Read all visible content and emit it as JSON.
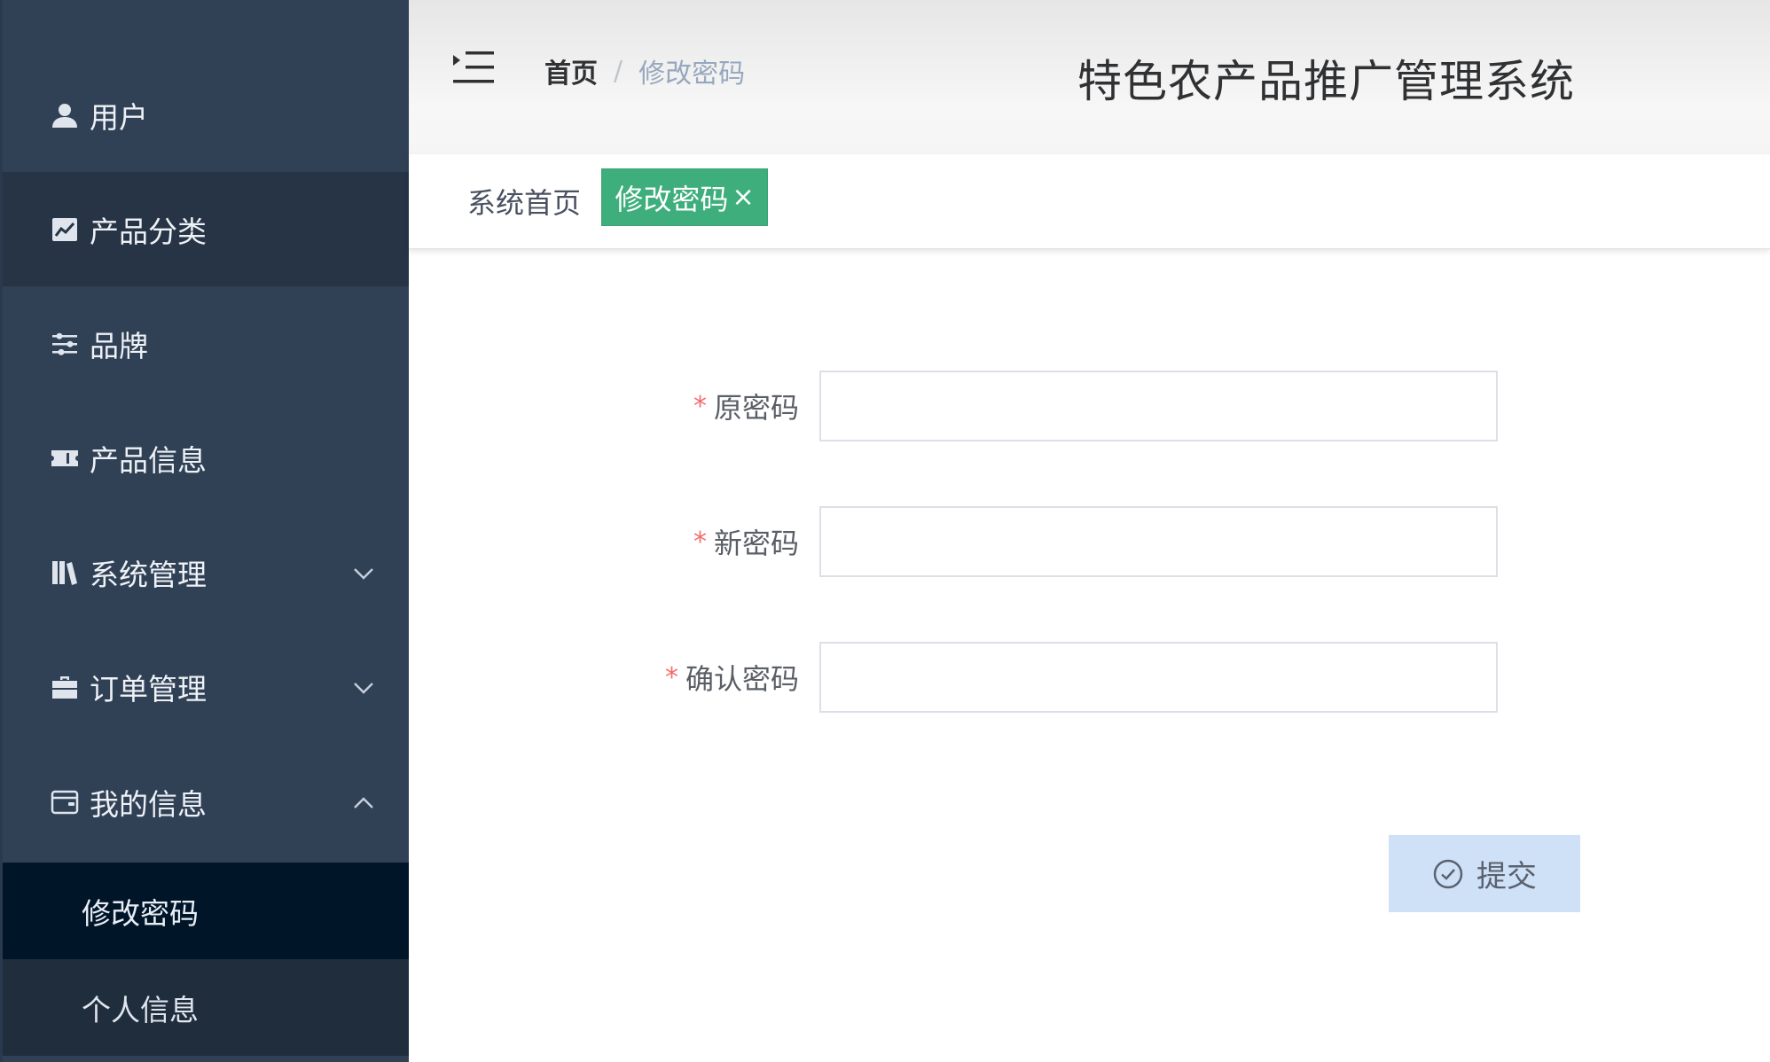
{
  "sidebar": {
    "items": [
      {
        "label": "用户",
        "icon": "user-icon"
      },
      {
        "label": "产品分类",
        "icon": "chart-icon"
      },
      {
        "label": "品牌",
        "icon": "sliders-icon"
      },
      {
        "label": "产品信息",
        "icon": "ticket-icon"
      },
      {
        "label": "系统管理",
        "icon": "books-icon",
        "expanded": false
      },
      {
        "label": "订单管理",
        "icon": "briefcase-icon",
        "expanded": false
      },
      {
        "label": "我的信息",
        "icon": "wallet-icon",
        "expanded": true
      }
    ],
    "submenu": [
      {
        "label": "修改密码",
        "selected": true
      },
      {
        "label": "个人信息",
        "selected": false
      }
    ]
  },
  "header": {
    "breadcrumb": {
      "home": "首页",
      "separator": "/",
      "current": "修改密码"
    },
    "system_title": "特色农产品推广管理系统"
  },
  "tags": {
    "home": "系统首页",
    "active": "修改密码",
    "close_symbol": "×",
    "active_color": "#3eae7c"
  },
  "form": {
    "required_mark": "*",
    "fields": [
      {
        "label": "原密码",
        "value": ""
      },
      {
        "label": "新密码",
        "value": ""
      },
      {
        "label": "确认密码",
        "value": ""
      }
    ],
    "submit_label": "提交"
  }
}
